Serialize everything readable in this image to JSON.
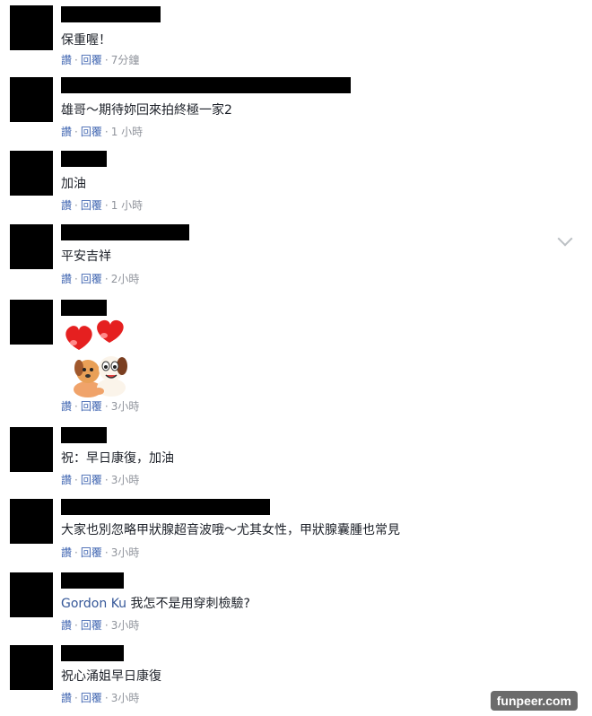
{
  "actions": {
    "like": "讚",
    "reply": "回覆",
    "dot": "·"
  },
  "comments": [
    {
      "text": "保重喔！",
      "time": "7分鐘"
    },
    {
      "text": "雄哥～期待妳回來拍終極一家2",
      "time": "1 小時"
    },
    {
      "text": "加油",
      "time": "1 小時"
    },
    {
      "text": "平安吉祥",
      "time": "2小時"
    },
    {
      "sticker": "hearts-dogs-sticker",
      "time": "3小時"
    },
    {
      "text": "祝：早日康復，加油",
      "time": "3小時"
    },
    {
      "text": "大家也別忽略甲狀腺超音波哦～尤其女性，甲狀腺囊腫也常見",
      "time": "3小時"
    },
    {
      "mention": "Gordon Ku",
      "text": "我怎不是用穿刺檢驗?",
      "time": "3小時"
    },
    {
      "text": "祝心涌姐早日康復 ",
      "time": "3小時"
    }
  ],
  "icons": {
    "menu": "chevron-down-icon"
  },
  "watermark": "funpeer.com"
}
